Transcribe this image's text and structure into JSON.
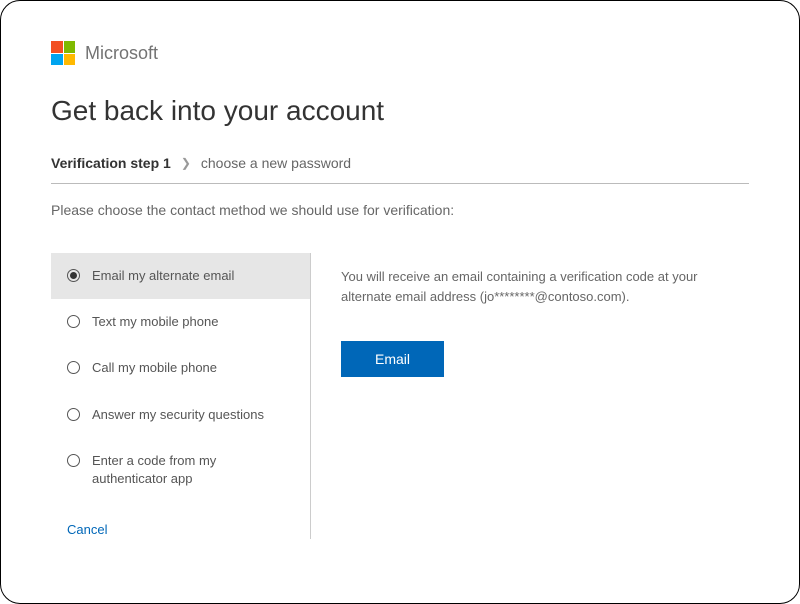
{
  "brand": {
    "name": "Microsoft"
  },
  "page": {
    "title": "Get back into your account",
    "breadcrumb_current": "Verification step 1",
    "breadcrumb_next": "choose a new password",
    "instruction": "Please choose the contact method we should use for verification:"
  },
  "methods": {
    "items": [
      {
        "label": "Email my alternate email",
        "selected": true
      },
      {
        "label": "Text my mobile phone",
        "selected": false
      },
      {
        "label": "Call my mobile phone",
        "selected": false
      },
      {
        "label": "Answer my security questions",
        "selected": false
      },
      {
        "label": "Enter a code from my authenticator app",
        "selected": false
      }
    ]
  },
  "details": {
    "description": "You will receive an email containing a verification code at your alternate email address (jo********@contoso.com).",
    "action_label": "Email"
  },
  "actions": {
    "cancel": "Cancel"
  }
}
